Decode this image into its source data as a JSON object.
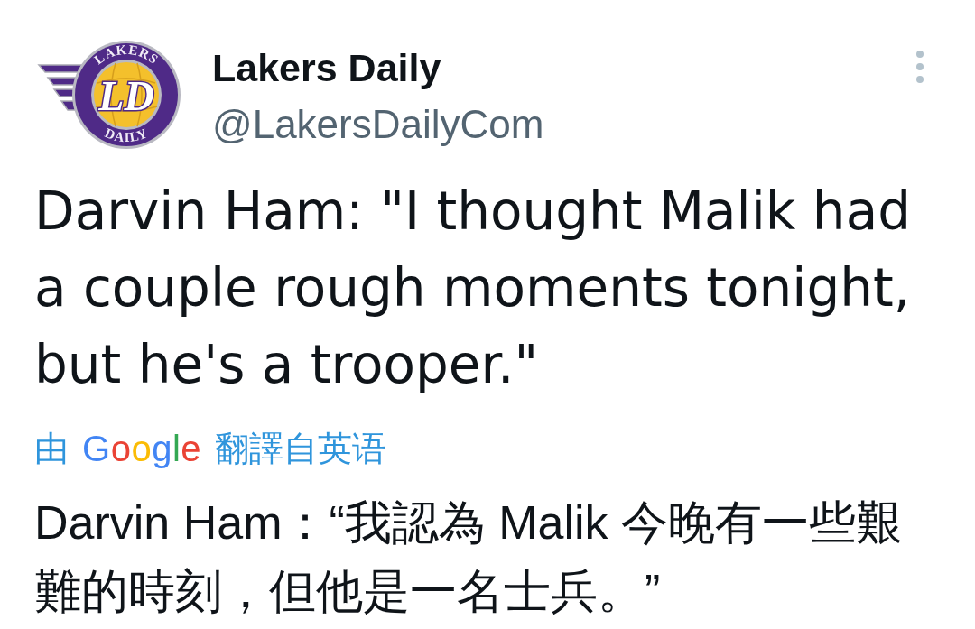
{
  "author": {
    "avatar": {
      "top_text": "LAKERS",
      "bottom_text": "DAILY",
      "monogram": "LD"
    },
    "name": "Lakers Daily",
    "handle": "@LakersDailyCom"
  },
  "tweet": {
    "text": "Darvin Ham: \"I thought Malik had a couple rough moments tonight, but he's a trooper.\""
  },
  "translation": {
    "prefix": "由",
    "provider": "Google",
    "suffix": "翻譯自英语",
    "text": "Darvin Ham：“我認為 Malik 今晚有一些艱難的時刻，但他是一名士兵。”"
  }
}
